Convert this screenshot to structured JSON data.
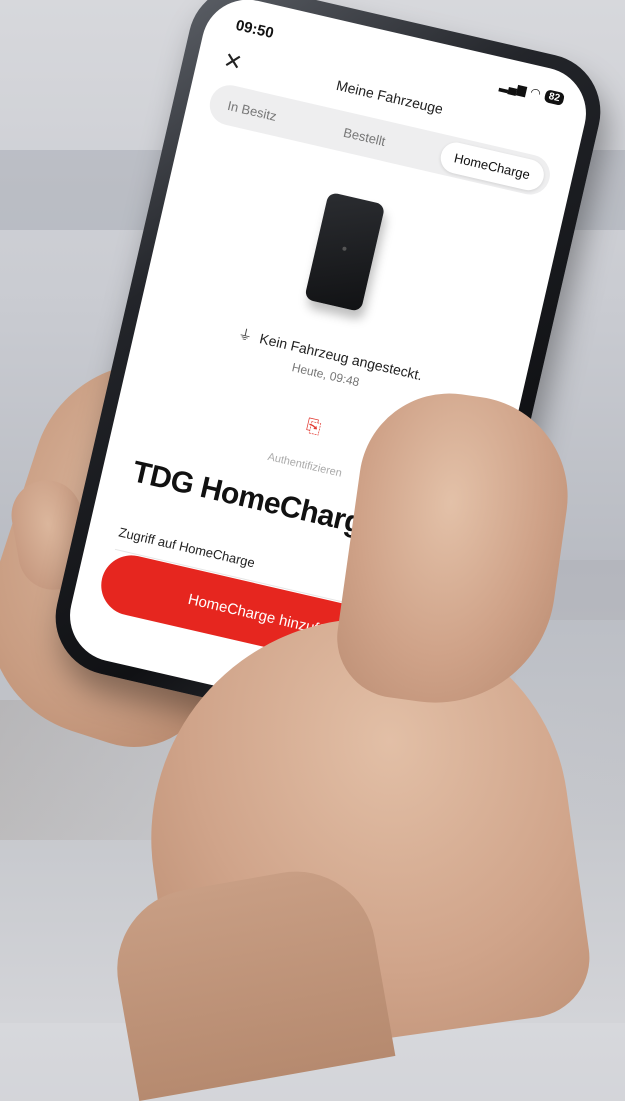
{
  "status_bar": {
    "time": "09:50",
    "battery": "82"
  },
  "nav": {
    "title": "Meine Fahrzeuge"
  },
  "tabs": [
    {
      "label": "In Besitz"
    },
    {
      "label": "Bestellt"
    },
    {
      "label": "HomeCharge"
    }
  ],
  "status": {
    "message": "Kein Fahrzeug angesteckt.",
    "timestamp": "Heute, 09:48"
  },
  "auth": {
    "label": "Authentifizieren"
  },
  "device": {
    "name": "TDG HomeCharge"
  },
  "access": {
    "label": "Zugriff auf HomeCharge"
  },
  "cta": {
    "label": "HomeCharge hinzufügen"
  },
  "colors": {
    "accent": "#e6261f",
    "icon_red": "#e23a32"
  }
}
